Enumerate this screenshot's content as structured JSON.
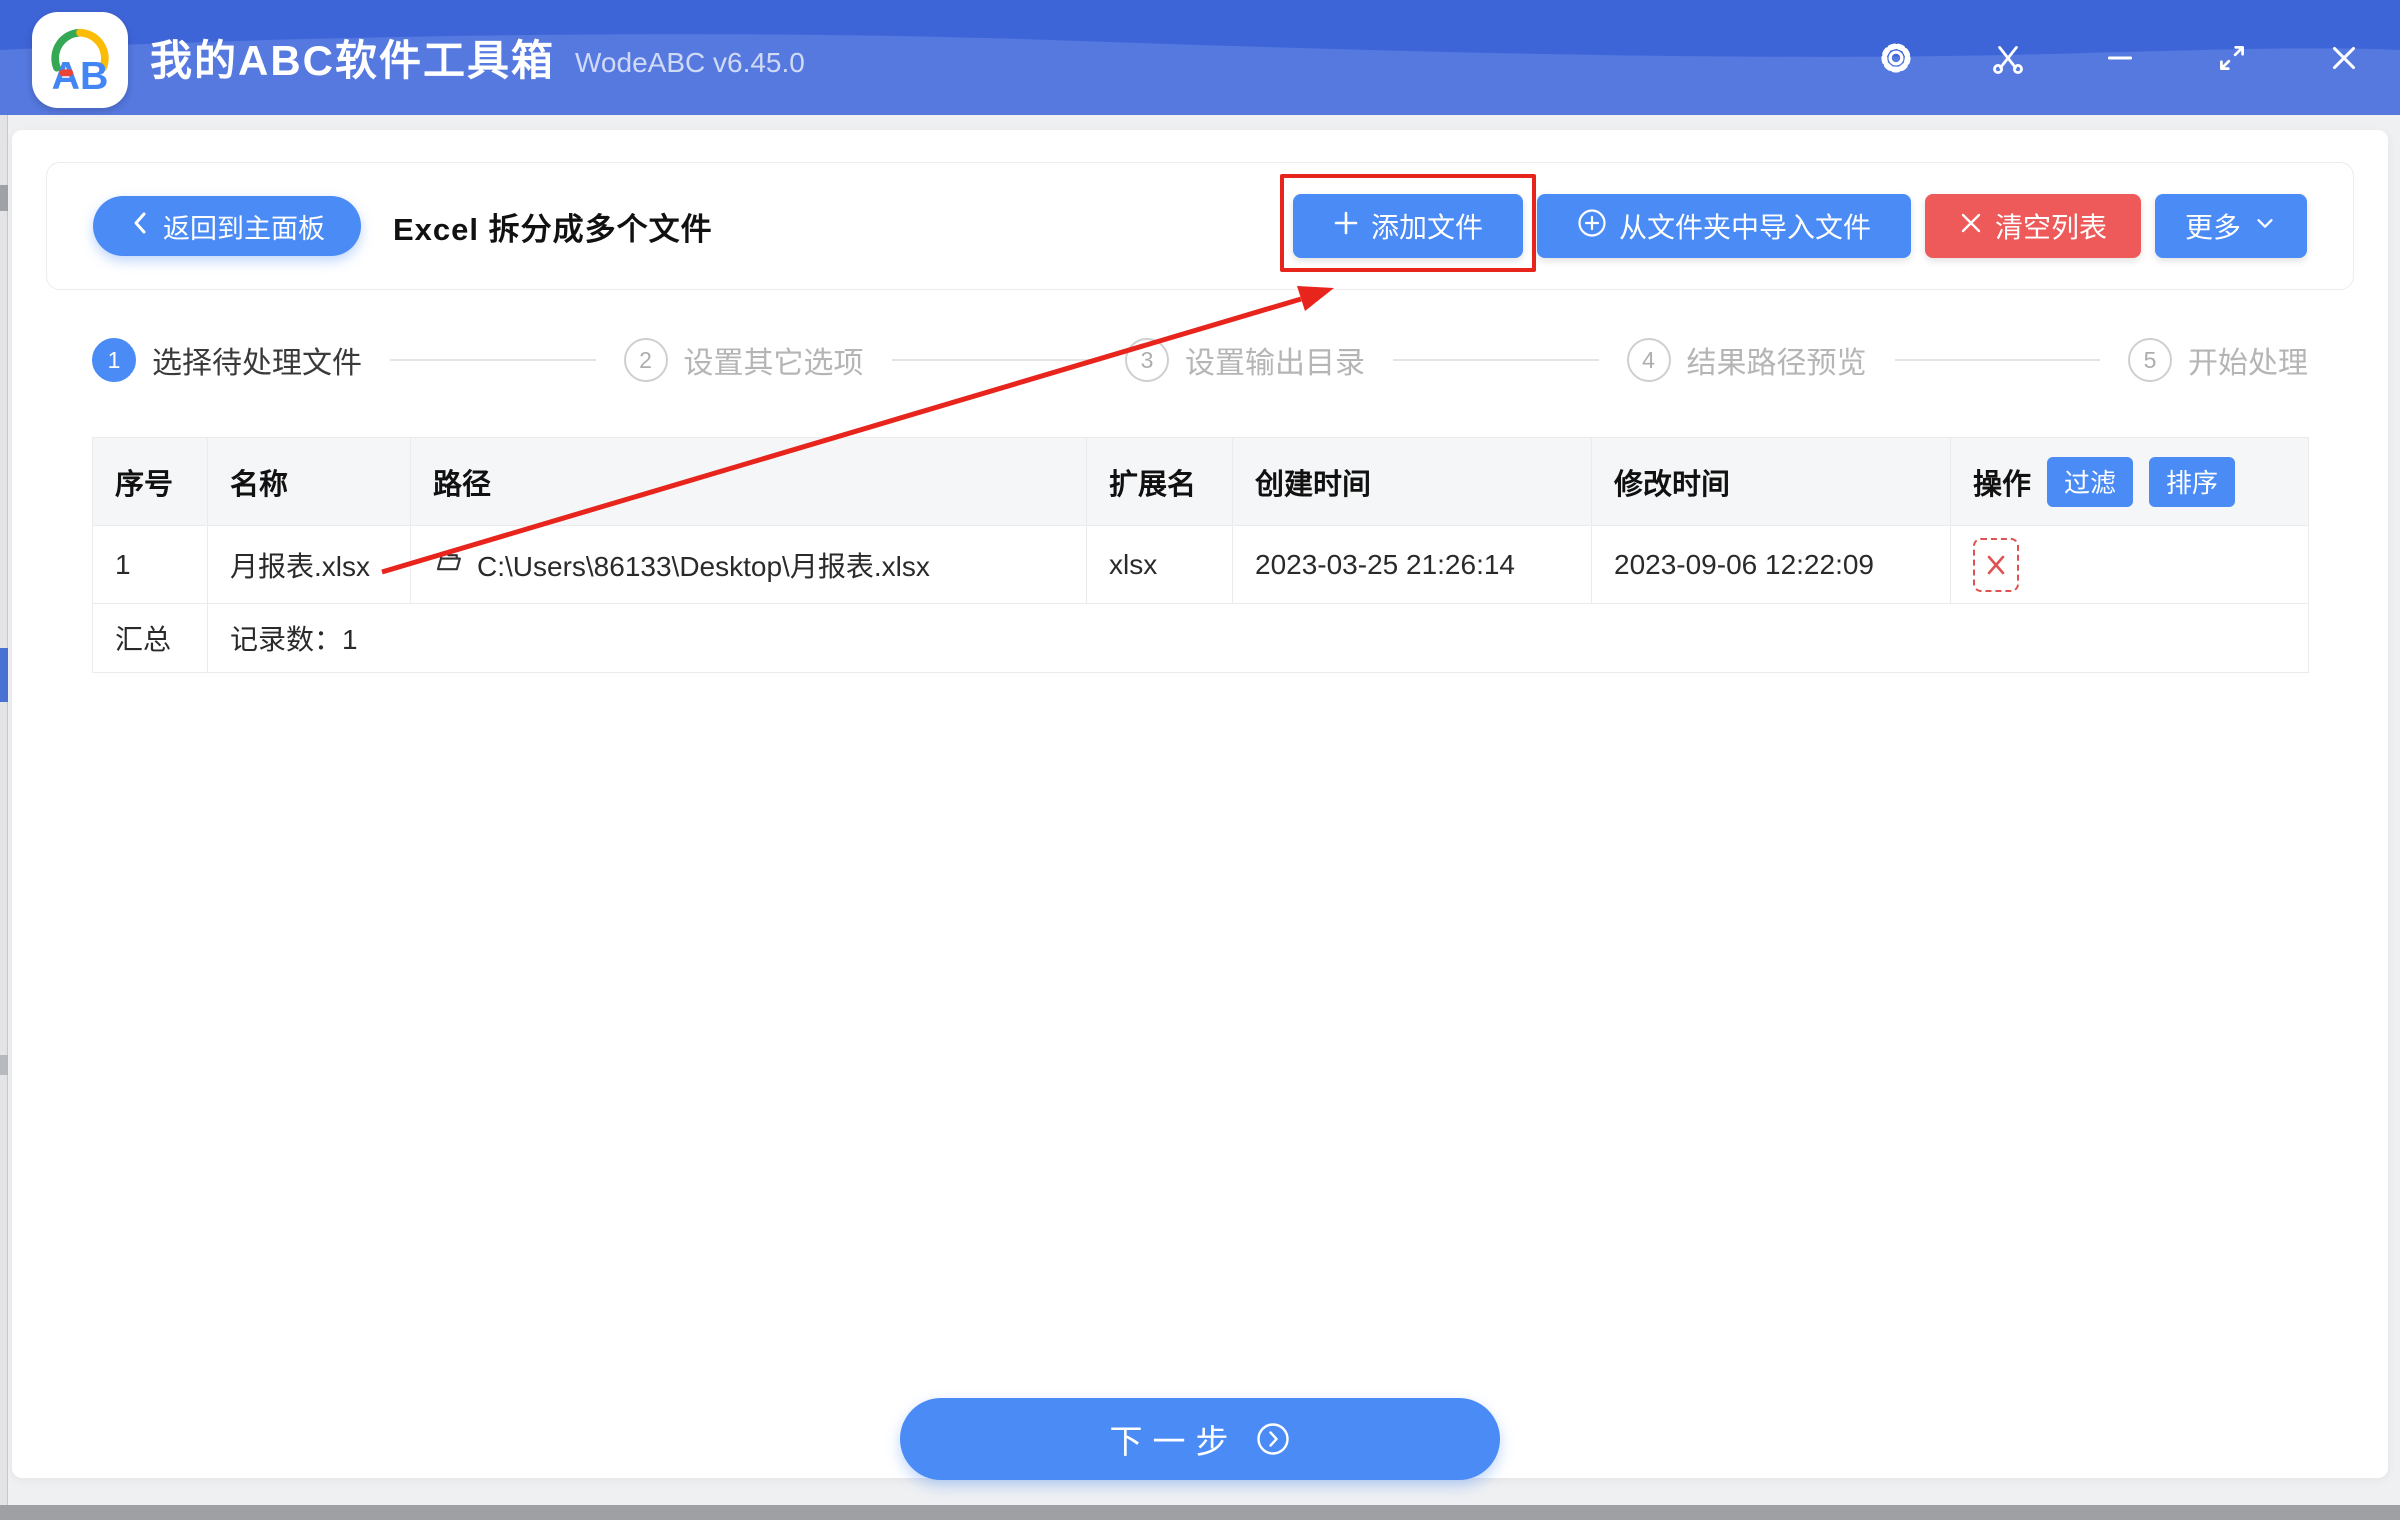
{
  "colors": {
    "accent": "#4A8BF5",
    "danger": "#EE5A5A",
    "annotation": "#E8251D",
    "titlebar-top": "#3E65D8",
    "titlebar-bottom": "#5679E0",
    "logo-green": "#34A853",
    "logo-yellow": "#FBBC05",
    "logo-blue": "#4285F4",
    "logo-red": "#EA4335"
  },
  "titlebar": {
    "app_title": "我的ABC软件工具箱",
    "version": "WodeABC v6.45.0",
    "logo_text": "AB",
    "window_icons": [
      "settings-icon",
      "scissors-icon",
      "minimize-icon",
      "maximize-icon",
      "close-icon"
    ]
  },
  "toolbar": {
    "back_label": "返回到主面板",
    "page_title": "Excel 拆分成多个文件",
    "add_files_label": "添加文件",
    "import_folder_label": "从文件夹中导入文件",
    "clear_list_label": "清空列表",
    "more_label": "更多"
  },
  "steps": [
    {
      "num": "1",
      "label": "选择待处理文件",
      "active": true
    },
    {
      "num": "2",
      "label": "设置其它选项",
      "active": false
    },
    {
      "num": "3",
      "label": "设置输出目录",
      "active": false
    },
    {
      "num": "4",
      "label": "结果路径预览",
      "active": false
    },
    {
      "num": "5",
      "label": "开始处理",
      "active": false
    }
  ],
  "table": {
    "headers": [
      "序号",
      "名称",
      "路径",
      "扩展名",
      "创建时间",
      "修改时间",
      "操作"
    ],
    "filter_label": "过滤",
    "sort_label": "排序",
    "rows": [
      {
        "no": "1",
        "name": "月报表.xlsx",
        "path": "C:\\Users\\86133\\Desktop\\月报表.xlsx",
        "ext": "xlsx",
        "created": "2023-03-25 21:26:14",
        "modified": "2023-09-06 12:22:09"
      }
    ],
    "summary_label": "汇总",
    "summary_value": "记录数：1"
  },
  "footer": {
    "next_label": "下一步"
  }
}
